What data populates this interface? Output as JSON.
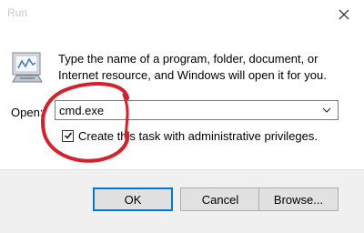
{
  "window": {
    "title": "Run",
    "close_icon": "close-icon",
    "app_icon": "run-dialog-icon"
  },
  "content": {
    "description": "Type the name of a program, folder, document, or Internet resource, and Windows will open it for you.",
    "open_label": "Open:",
    "open_value": "cmd.exe",
    "admin_checked": true,
    "admin_label": "Create this task with administrative privileges."
  },
  "buttons": {
    "ok": "OK",
    "cancel": "Cancel",
    "browse": "Browse..."
  },
  "colors": {
    "annotation_red": "#d9202a",
    "footer_bg": "#f0f0f0",
    "focus_blue": "#0078d7"
  }
}
